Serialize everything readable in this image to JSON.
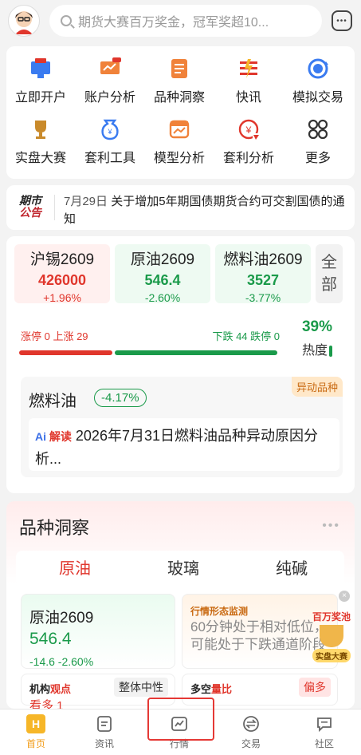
{
  "header": {
    "search_placeholder": "期货大赛百万奖金，冠军奖超10..."
  },
  "quick_actions": [
    {
      "label": "立即开户",
      "icon": "open-account-icon"
    },
    {
      "label": "账户分析",
      "icon": "account-analysis-icon"
    },
    {
      "label": "品种洞察",
      "icon": "variety-insight-icon"
    },
    {
      "label": "快讯",
      "icon": "flash-news-icon"
    },
    {
      "label": "模拟交易",
      "icon": "simulated-trading-icon"
    },
    {
      "label": "实盘大赛",
      "icon": "trophy-icon"
    },
    {
      "label": "套利工具",
      "icon": "arbitrage-tool-icon"
    },
    {
      "label": "模型分析",
      "icon": "model-analysis-icon"
    },
    {
      "label": "套利分析",
      "icon": "arbitrage-analysis-icon"
    },
    {
      "label": "更多",
      "icon": "more-grid-icon"
    }
  ],
  "notice": {
    "tag_top": "期市",
    "tag_bottom": "公告",
    "date": "7月29日",
    "text": "关于增加5年期国债期货合约可交割国债的通知"
  },
  "market": {
    "cells": [
      {
        "name": "沪锡2609",
        "price": "426000",
        "change": "+1.96%",
        "trend": "up"
      },
      {
        "name": "原油2609",
        "price": "546.4",
        "change": "-2.60%",
        "trend": "down"
      },
      {
        "name": "燃料油2609",
        "price": "3527",
        "change": "-3.77%",
        "trend": "down"
      }
    ],
    "all_label": "全部",
    "up_label": "涨停 0  上涨 29",
    "down_label": "下跌 44  跌停 0",
    "up_count": 29,
    "down_count": 44,
    "heat_value": "39%",
    "heat_label": "热度",
    "alert": {
      "badge": "异动品种",
      "name": "燃料油",
      "change": "-4.17%",
      "ai_label_1": "Ai",
      "ai_label_2": "解读",
      "ai_text": "2026年7月31日燃料油品种异动原因分析..."
    }
  },
  "insight": {
    "title": "品种洞察",
    "more": "•••",
    "tabs": [
      "原油",
      "玻璃",
      "纯碱"
    ],
    "active_tab": 0,
    "left_card": {
      "name": "原油2609",
      "price": "546.4",
      "change": "-14.6  -2.60%"
    },
    "right_card": {
      "monitor_title": "行情形态监测",
      "monitor_text": "60分钟处于相对低位，可能处于下跌通道阶段"
    },
    "pool": {
      "label": "百万奖池",
      "tag": "实盘大赛"
    },
    "sub_left": {
      "title_1": "机构",
      "title_2": "观点",
      "tag": "整体中性",
      "value": "看多 1"
    },
    "sub_right": {
      "title_1": "多空",
      "title_2": "量比",
      "tag": "偏多"
    }
  },
  "nav": [
    {
      "label": "首页",
      "icon": "home-icon"
    },
    {
      "label": "资讯",
      "icon": "news-icon"
    },
    {
      "label": "行情",
      "icon": "market-chart-icon"
    },
    {
      "label": "交易",
      "icon": "trade-icon"
    },
    {
      "label": "社区",
      "icon": "community-icon"
    }
  ],
  "colors": {
    "up": "#e0362c",
    "down": "#1a9a4a",
    "accent": "#f29d1b"
  }
}
